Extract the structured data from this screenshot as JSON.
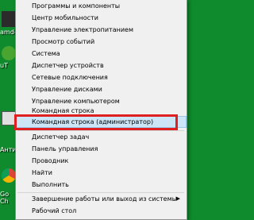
{
  "menu": {
    "items": [
      {
        "label": "Программы и компоненты"
      },
      {
        "label": "Центр мобильности"
      },
      {
        "label": "Управление электропитанием"
      },
      {
        "label": "Просмотр событий"
      },
      {
        "label": "Система"
      },
      {
        "label": "Диспетчер устройств"
      },
      {
        "label": "Сетевые подключения"
      },
      {
        "label": "Управление дисками"
      },
      {
        "label": "Управление компьютером"
      },
      {
        "label": "Командная строка"
      },
      {
        "label": "Командная строка (администратор)"
      },
      {
        "label": "Диспетчер задач"
      },
      {
        "label": "Панель управления"
      },
      {
        "label": "Проводник"
      },
      {
        "label": "Найти"
      },
      {
        "label": "Выполнить"
      },
      {
        "label": "Завершение работы или выход из системы"
      },
      {
        "label": "Рабочий стол"
      }
    ],
    "highlighted_index": 10
  },
  "desktop": {
    "icons": [
      {
        "label": "amd-"
      },
      {
        "label": "uT"
      },
      {
        "label": "Анти"
      },
      {
        "label": "Go"
      },
      {
        "label": "Ch"
      }
    ]
  },
  "colors": {
    "desktop_bg": "#0f8a2c",
    "menu_bg": "#f0f0f0",
    "highlight_bg": "#cde6f7",
    "annotation_red": "#e02020"
  }
}
